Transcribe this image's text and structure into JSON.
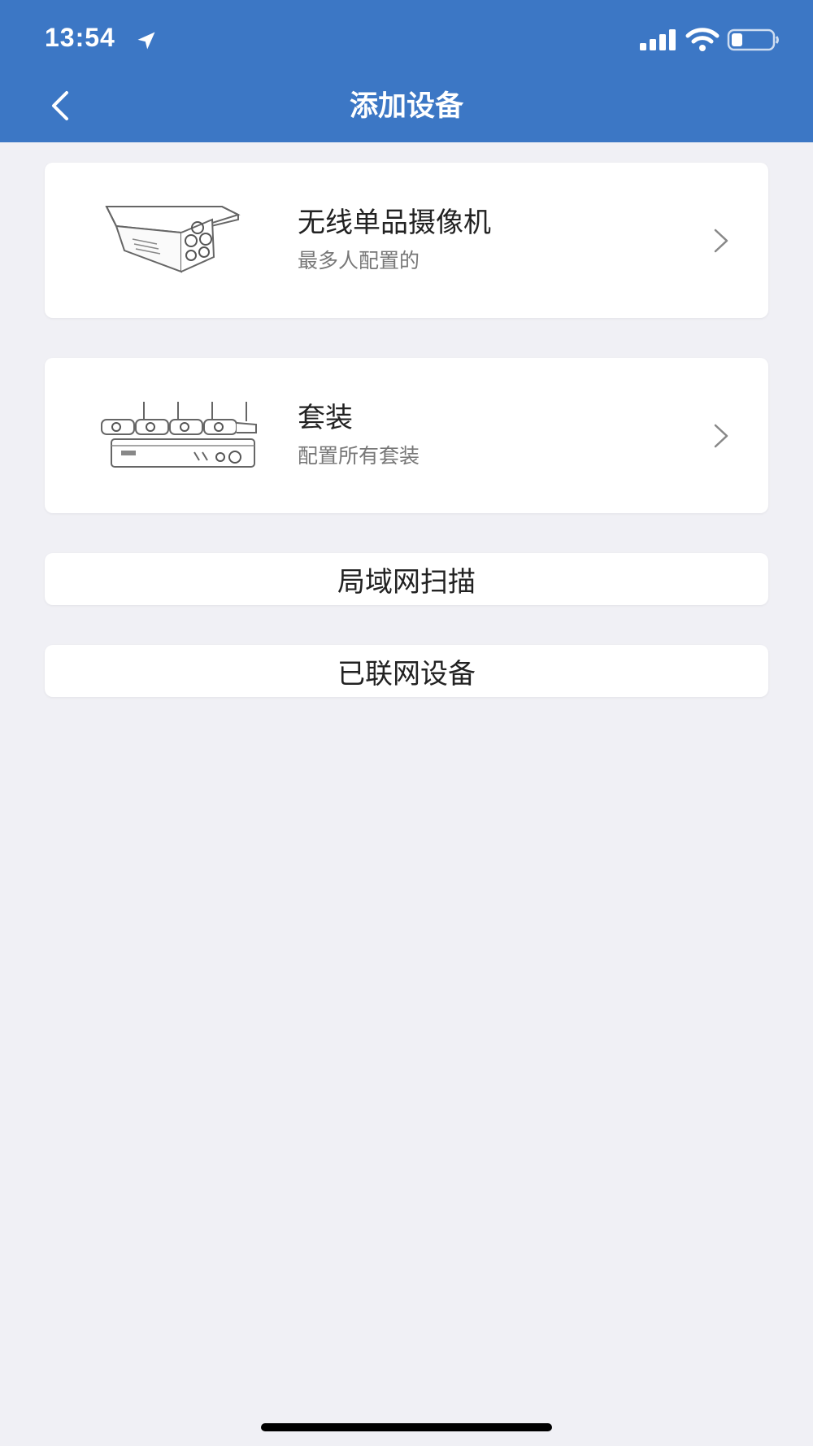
{
  "status_bar": {
    "time": "13:54",
    "icons": [
      "location-arrow-icon",
      "signal-icon",
      "wifi-icon",
      "battery-icon"
    ],
    "battery_level": 0.2
  },
  "header": {
    "title": "添加设备",
    "back_icon": "chevron-left-icon",
    "background_color": "#3c77c5"
  },
  "device_options": [
    {
      "title": "无线单品摄像机",
      "subtitle": "最多人配置的",
      "image": "bullet-camera-illustration",
      "icon": "chevron-right-icon"
    },
    {
      "title": "套装",
      "subtitle": "配置所有套装",
      "image": "camera-kit-nvr-illustration",
      "icon": "chevron-right-icon"
    }
  ],
  "actions": [
    {
      "label": "局域网扫描"
    },
    {
      "label": "已联网设备"
    }
  ]
}
